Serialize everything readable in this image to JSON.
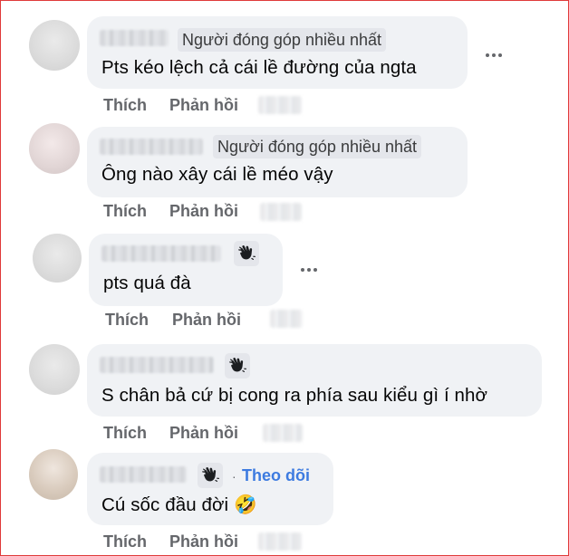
{
  "comments": [
    {
      "badge": "Người đóng góp nhiều nhất",
      "text": "Pts kéo lệch cả cái lề đường của ngta",
      "like_label": "Thích",
      "reply_label": "Phản hồi",
      "has_menu": true
    },
    {
      "badge": "Người đóng góp nhiều nhất",
      "text": "Ông nào xây cái lề méo vậy",
      "like_label": "Thích",
      "reply_label": "Phản hồi"
    },
    {
      "badge_icon": "wave-hand-icon",
      "text": "pts quá đà",
      "like_label": "Thích",
      "reply_label": "Phản hồi",
      "has_menu": true
    },
    {
      "badge_icon": "wave-hand-icon",
      "text": "S chân bả cứ bị cong ra phía sau kiểu gì í nhờ",
      "like_label": "Thích",
      "reply_label": "Phản hồi"
    },
    {
      "badge_icon": "wave-hand-icon",
      "follow_label": "Theo dõi",
      "text": "Cú sốc đầu đời",
      "emoji": "🤣",
      "like_label": "Thích",
      "reply_label": "Phản hồi"
    }
  ],
  "colors": {
    "bubble": "#f0f2f5",
    "action_text": "#65676b",
    "follow_link": "#3d7be0",
    "frame_border": "#e03a3a"
  }
}
